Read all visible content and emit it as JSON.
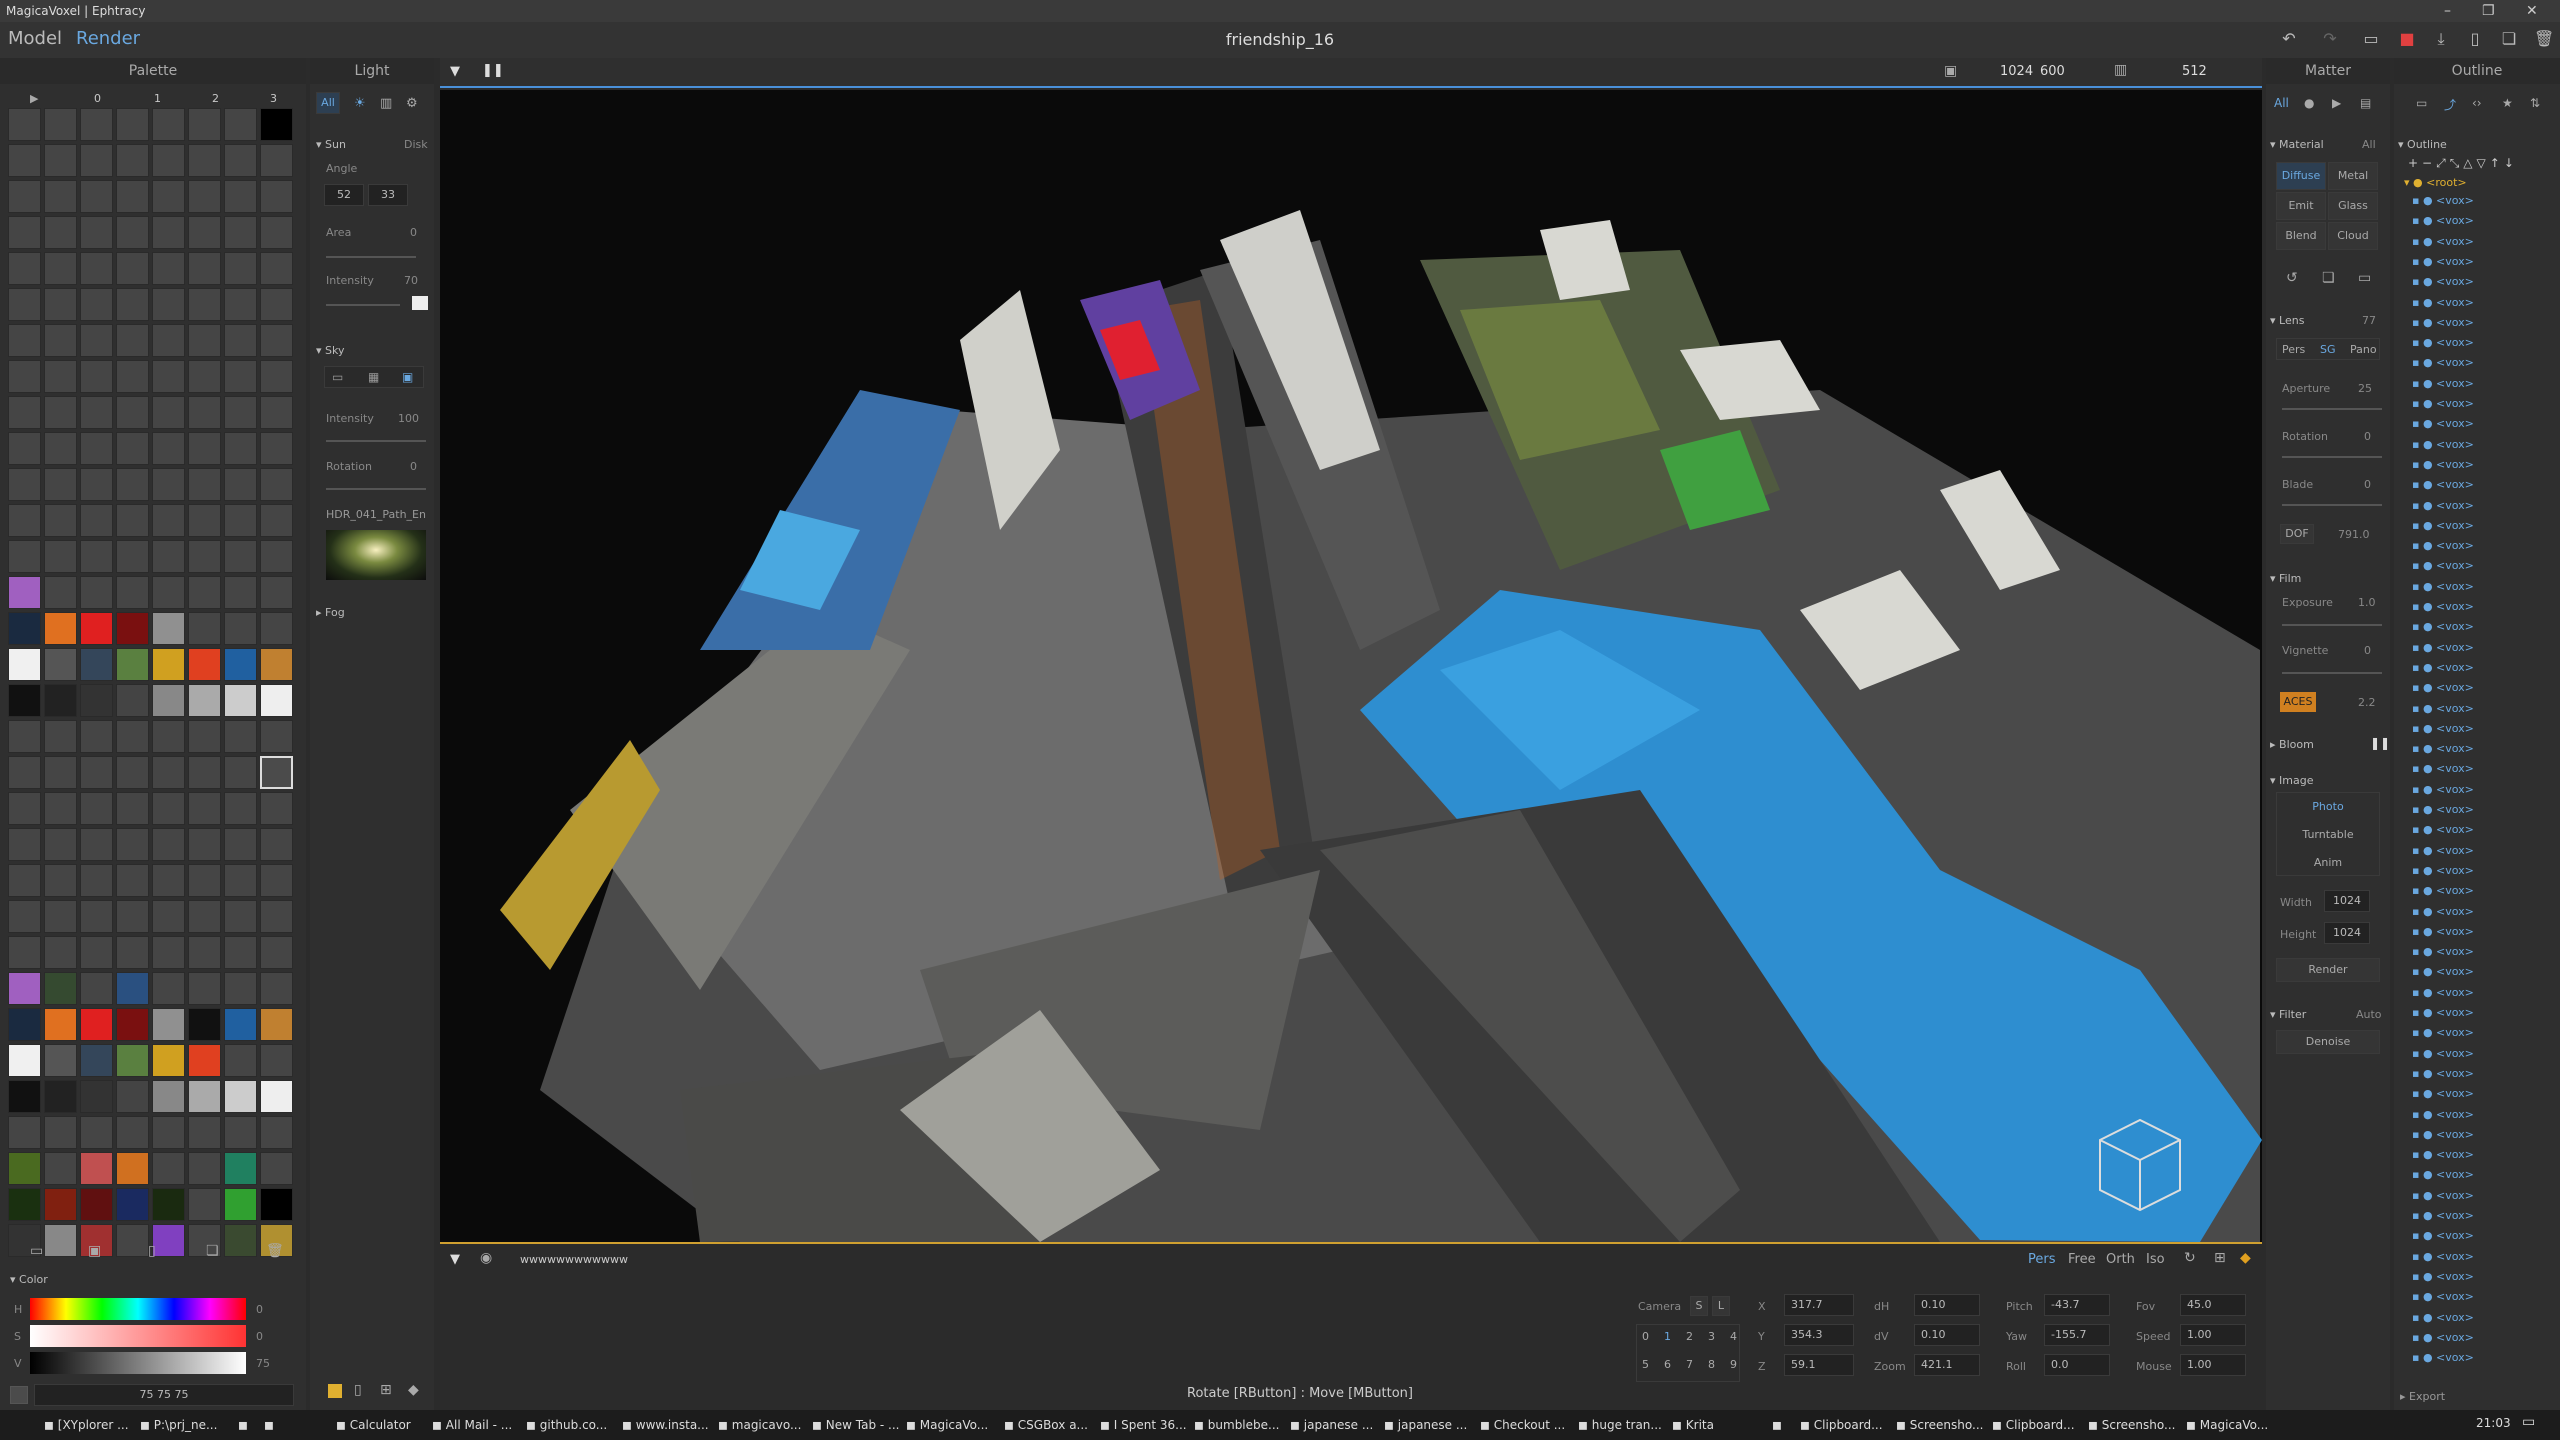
{
  "titlebar": {
    "title": "MagicaVoxel | Ephtracy"
  },
  "menu": {
    "model": "Model",
    "render": "Render",
    "document": "friendship_16"
  },
  "palette": {
    "title": "Palette",
    "cols": [
      "0",
      "1",
      "2",
      "3"
    ],
    "value": "75 75 75",
    "color_label": "Color",
    "hsv": [
      {
        "k": "H",
        "v": "0"
      },
      {
        "k": "S",
        "v": "0"
      },
      {
        "k": "V",
        "v": "75"
      }
    ]
  },
  "light": {
    "title": "Light",
    "tab_all": "All",
    "sun": "Sun",
    "disk": "Disk",
    "angle": "Angle",
    "angle1": "52",
    "angle2": "33",
    "area": "Area",
    "area_val": "0",
    "intensity": "Intensity",
    "intensity_val": "70",
    "sky": "Sky",
    "sky_intensity": "Intensity",
    "sky_intensity_val": "100",
    "rotation": "Rotation",
    "rotation_val": "0",
    "hdr": "HDR_041_Path_En",
    "fog": "Fog"
  },
  "viewport": {
    "size_w": "1024",
    "size_h": "600",
    "samples": "512",
    "console": "wwwwwwwwwwww",
    "modes": [
      "Pers",
      "Free",
      "Orth",
      "Iso"
    ],
    "status": "Rotate [RButton] : Move [MButton]"
  },
  "camera": {
    "label": "Camera",
    "s": "S",
    "l": "L",
    "slots1": [
      "0",
      "1",
      "2",
      "3",
      "4"
    ],
    "slots2": [
      "5",
      "6",
      "7",
      "8",
      "9"
    ],
    "x_label": "X",
    "x": "317.7",
    "y_label": "Y",
    "y": "354.3",
    "z_label": "Z",
    "z": "59.1",
    "dh_label": "dH",
    "dh": "0.10",
    "dv_label": "dV",
    "dv": "0.10",
    "zoom_label": "Zoom",
    "zoom": "421.1",
    "pitch_label": "Pitch",
    "pitch": "-43.7",
    "yaw_label": "Yaw",
    "yaw": "-155.7",
    "roll_label": "Roll",
    "roll": "0.0",
    "fov_label": "Fov",
    "fov": "45.0",
    "speed_label": "Speed",
    "speed": "1.00",
    "mouse_label": "Mouse",
    "mouse": "1.00"
  },
  "matter": {
    "title": "Matter",
    "all": "All",
    "material": "Material",
    "mat_all": "All",
    "materials": [
      "Diffuse",
      "Metal",
      "Emit",
      "Glass",
      "Blend",
      "Cloud"
    ],
    "lens": "Lens",
    "lens_val": "77",
    "lens_modes": [
      "Pers",
      "SG",
      "Pano"
    ],
    "aperture": "Aperture",
    "aperture_val": "25",
    "rotation": "Rotation",
    "rotation_val": "0",
    "blade": "Blade",
    "blade_val": "0",
    "dof": "DOF",
    "dof_val": "791.0",
    "film": "Film",
    "exposure": "Exposure",
    "exposure_val": "1.0",
    "vignette": "Vignette",
    "vignette_val": "0",
    "aces": "ACES",
    "aces_val": "2.2",
    "bloom": "Bloom",
    "image": "Image",
    "image_modes": [
      "Photo",
      "Turntable",
      "Anim"
    ],
    "width": "Width",
    "width_val": "1024",
    "height": "Height",
    "height_val": "1024",
    "render_btn": "Render",
    "filter": "Filter",
    "filter_auto": "Auto",
    "denoise": "Denoise"
  },
  "outline": {
    "title": "Outline",
    "section": "Outline",
    "root": "<root>",
    "item": "<vox>",
    "export": "Export"
  },
  "taskbar": {
    "items": [
      "[XYplorer ...",
      "P:\\prj_ne...",
      "",
      "",
      "Calculator",
      "All Mail - ...",
      "github.co...",
      "www.insta...",
      "magicavo...",
      "New Tab - ...",
      "MagicaVo...",
      "CSGBox a...",
      "I Spent 36...",
      "bumblebe...",
      "japanese ...",
      "japanese ...",
      "Checkout ...",
      "huge tran...",
      "Krita",
      "",
      "Clipboard...",
      "Screensho...",
      "Clipboard...",
      "Screensho...",
      "MagicaVo..."
    ],
    "time": "21:03"
  },
  "colors": {
    "accent": "#4a90d9",
    "selected": "#6aa8e0",
    "aces": "#d08020"
  }
}
